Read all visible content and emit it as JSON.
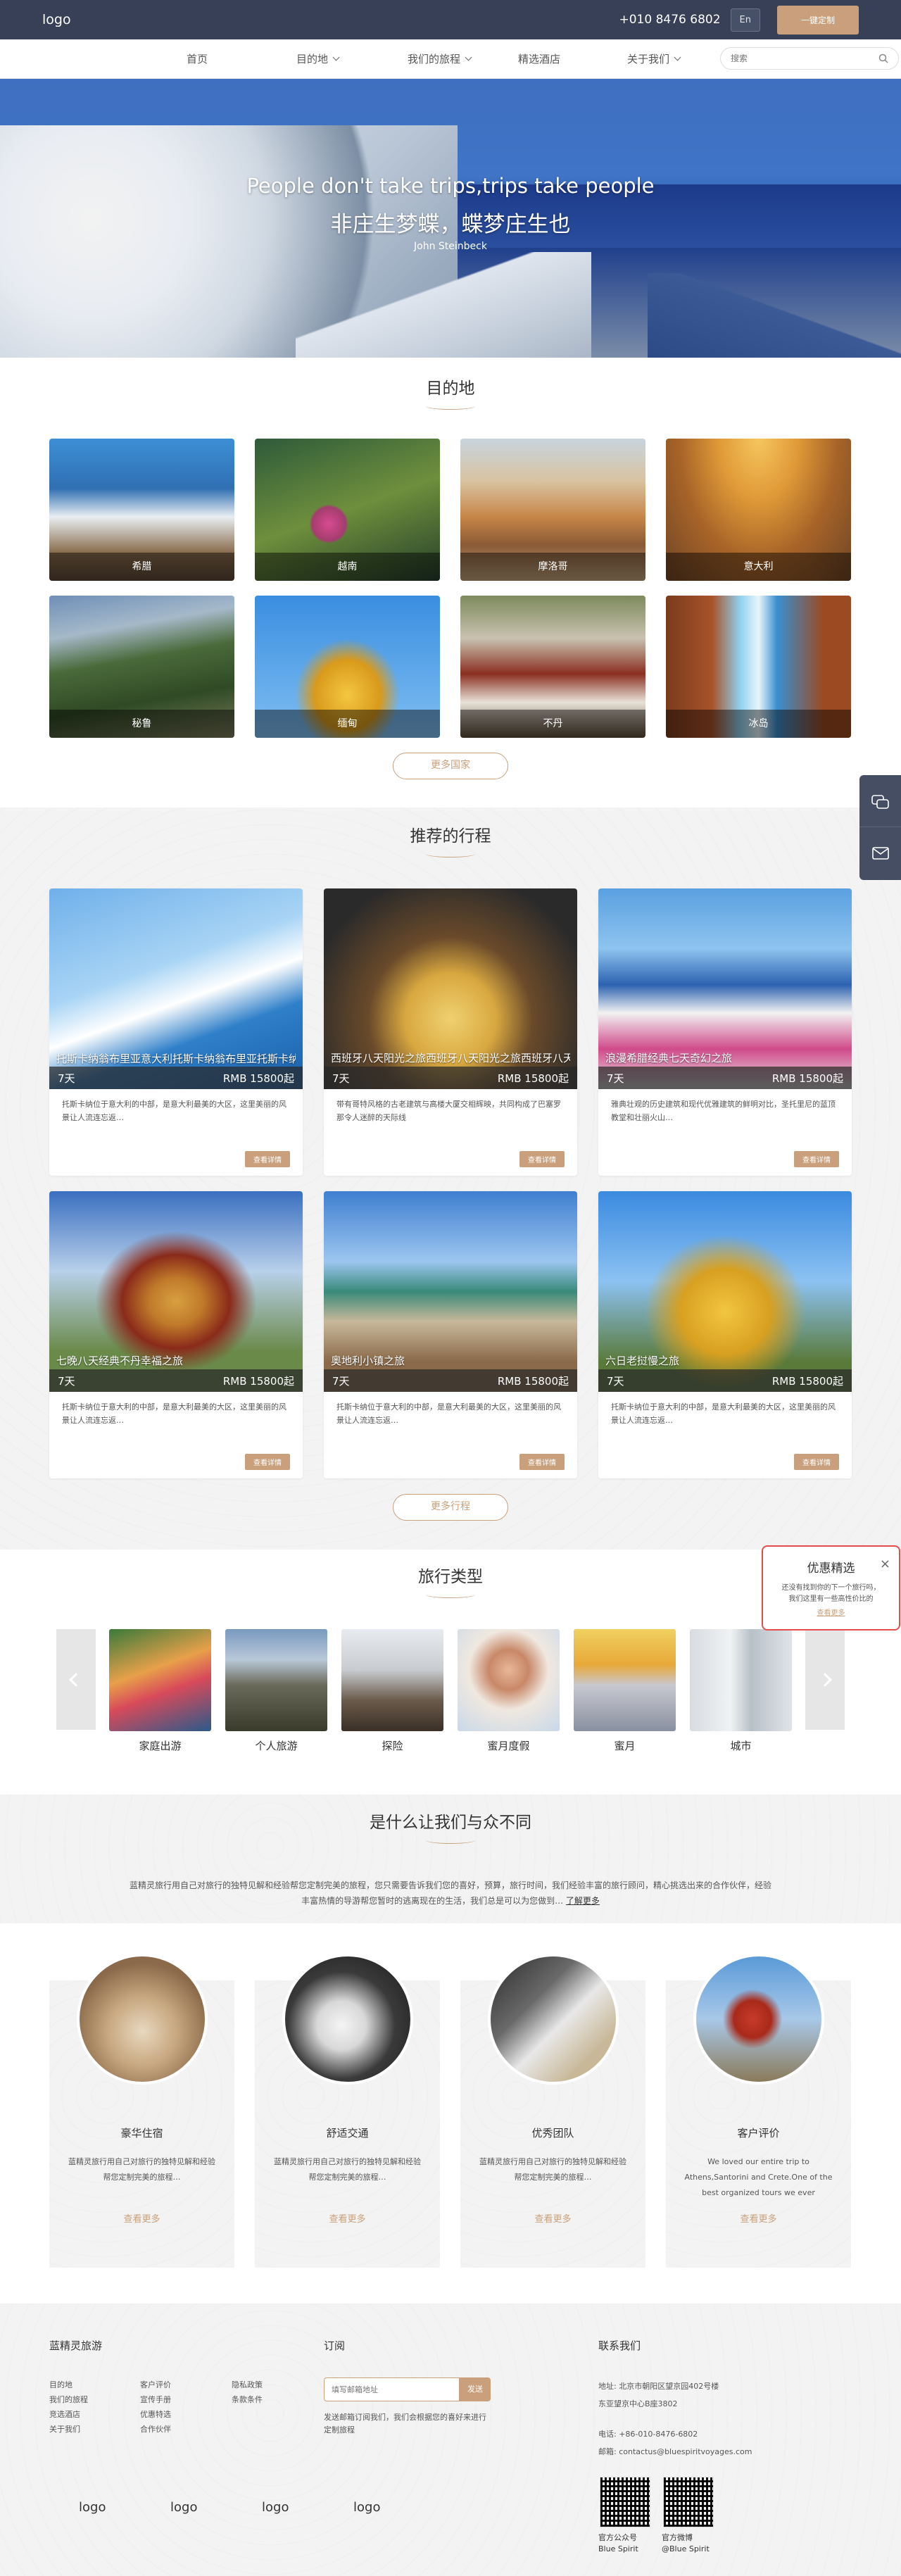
{
  "topbar": {
    "logo": "logo",
    "phone": "+010 8476 6802",
    "lang": "En",
    "cta": "一键定制"
  },
  "nav": {
    "items": [
      "首页",
      "目的地",
      "我们的旅程",
      "精选酒店",
      "关于我们"
    ],
    "search_placeholder": "搜索"
  },
  "hero": {
    "title": "People don't take trips,trips take people",
    "subtitle": "非庄生梦蝶，蝶梦庄生也",
    "author": "John Steinbeck"
  },
  "destinations": {
    "title": "目的地",
    "items": [
      "希腊",
      "越南",
      "摩洛哥",
      "意大利",
      "秘鲁",
      "缅甸",
      "不丹",
      "冰岛"
    ],
    "more": "更多国家"
  },
  "trips": {
    "title": "推荐的行程",
    "items": [
      {
        "name": "托斯卡纳翁布里亚意大利托斯卡纳翁布里亚托斯卡纳翁布里亚托斯卡纳翁布里亚",
        "days": "7天",
        "price": "RMB 15800起",
        "desc": "托斯卡纳位于意大利的中部，是意大利最美的大区，这里美丽的风景让人流连忘返…",
        "more": "查看详情"
      },
      {
        "name": "西班牙八天阳光之旅西班牙八天阳光之旅西班牙八天阳光之旅",
        "days": "7天",
        "price": "RMB 15800起",
        "desc": "带有哥特风格的古老建筑与高楼大厦交相辉映，共同构成了巴塞罗那令人迷醉的天际线",
        "more": "查看详情"
      },
      {
        "name": "浪漫希腊经典七天奇幻之旅",
        "days": "7天",
        "price": "RMB 15800起",
        "desc": "雅典壮观的历史建筑和现代优雅建筑的鲜明对比，圣托里尼的蓝顶教堂和壮丽火山…",
        "more": "查看详情"
      },
      {
        "name": "七晚八天经典不丹幸福之旅",
        "days": "7天",
        "price": "RMB 15800起",
        "desc": "托斯卡纳位于意大利的中部，是意大利最美的大区，这里美丽的风景让人流连忘返…",
        "more": "查看详情"
      },
      {
        "name": "奥地利小镇之旅",
        "days": "7天",
        "price": "RMB 15800起",
        "desc": "托斯卡纳位于意大利的中部，是意大利最美的大区，这里美丽的风景让人流连忘返…",
        "more": "查看详情"
      },
      {
        "name": "六日老挝慢之旅",
        "days": "7天",
        "price": "RMB 15800起",
        "desc": "托斯卡纳位于意大利的中部，是意大利最美的大区，这里美丽的风景让人流连忘返…",
        "more": "查看详情"
      }
    ],
    "more": "更多行程"
  },
  "types": {
    "title": "旅行类型",
    "items": [
      "家庭出游",
      "个人旅游",
      "探险",
      "蜜月度假",
      "蜜月",
      "城市"
    ]
  },
  "diff": {
    "title": "是什么让我们与众不同",
    "text": "蓝精灵旅行用自己对旅行的独特见解和经验帮您定制完美的旅程，您只需要告诉我们您的喜好，预算，旅行时间，我们经验丰富的旅行顾问，精心挑选出来的合作伙伴，经验丰富热情的导游帮您暂时的逃离现在的生活，我们总是可以为您做到…",
    "link": "了解更多"
  },
  "features": [
    {
      "title": "豪华住宿",
      "desc": "蓝精灵旅行用自己对旅行的独特见解和经验帮您定制完美的旅程…",
      "more": "查看更多"
    },
    {
      "title": "舒适交通",
      "desc": "蓝精灵旅行用自己对旅行的独特见解和经验帮您定制完美的旅程…",
      "more": "查看更多"
    },
    {
      "title": "优秀团队",
      "desc": "蓝精灵旅行用自己对旅行的独特见解和经验帮您定制完美的旅程…",
      "more": "查看更多"
    },
    {
      "title": "客户评价",
      "desc": "We loved our entire trip to Athens,Santorini and Crete.One of the best organized tours we ever",
      "more": "查看更多"
    }
  ],
  "footer": {
    "brand": "蓝精灵旅游",
    "col1": [
      "目的地",
      "我们的旅程",
      "竞选酒店",
      "关于我们"
    ],
    "col2": [
      "客户评价",
      "宣传手册",
      "优惠特选",
      "合作伙伴"
    ],
    "col3": [
      "隐私政策",
      "条款条件"
    ],
    "subscribe_title": "订阅",
    "subscribe_placeholder": "填写邮箱地址",
    "subscribe_btn": "发送",
    "subscribe_note": "发送邮箱订阅我们，我们会根据您的喜好来进行定制旅程",
    "contact_title": "联系我们",
    "address": "地址: 北京市朝阳区望京园402号楼",
    "address2": "东亚望京中心B座3802",
    "tel": "电话: +86-010-8476-6802",
    "email": "邮箱: contactus@bluespiritvoyages.com",
    "logos": [
      "logo",
      "logo",
      "logo",
      "logo"
    ],
    "qr1": [
      "官方公众号",
      "Blue Spirit"
    ],
    "qr2": [
      "官方微博",
      "@Blue Spirit"
    ]
  },
  "popup": {
    "title": "优惠精选",
    "desc1": "还没有找到你的下一个旅行吗，",
    "desc2": "我们这里有一些高性价比的",
    "link": "查看更多"
  }
}
